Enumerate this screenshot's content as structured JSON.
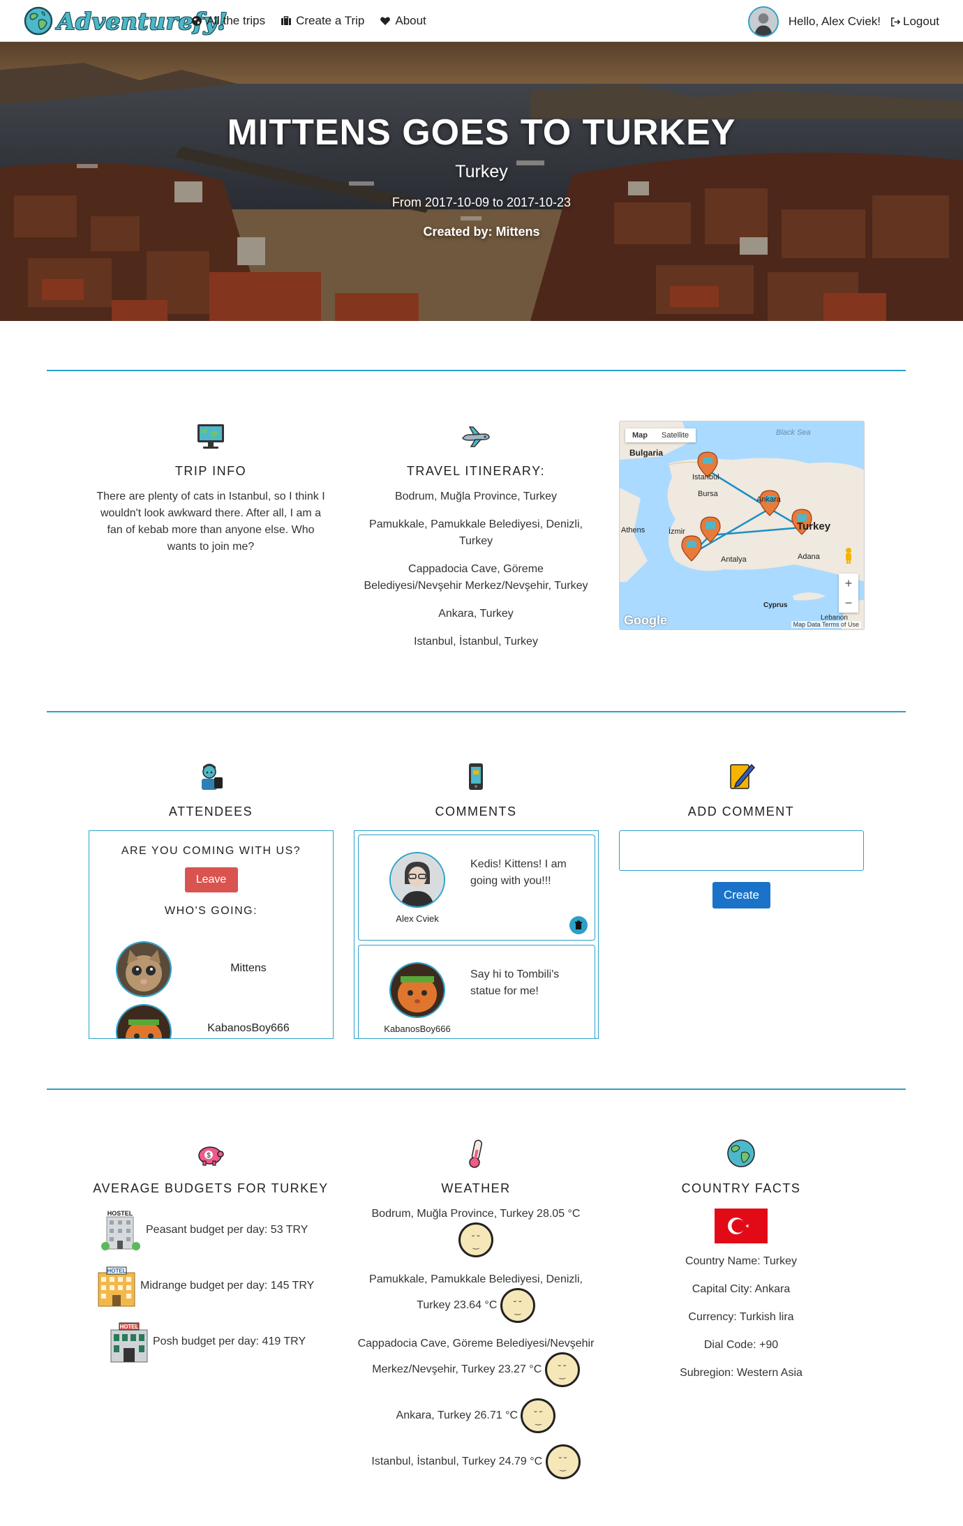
{
  "nav": {
    "brand": "Adventurefy!",
    "links": [
      {
        "label": "All the trips",
        "icon": "globe-icon"
      },
      {
        "label": "Create a Trip",
        "icon": "briefcase-icon"
      },
      {
        "label": "About",
        "icon": "heart-icon"
      }
    ],
    "greeting": "Hello, Alex Cviek!",
    "logout": "Logout"
  },
  "hero": {
    "title": "MITTENS GOES TO TURKEY",
    "country": "Turkey",
    "dates": "From 2017-10-09 to 2017-10-23",
    "creator": "Created by: Mittens"
  },
  "trip_info": {
    "heading": "TRIP INFO",
    "description": "There are plenty of cats in Istanbul, so I think I wouldn't look awkward there. After all, I am a fan of kebab more than anyone else. Who wants to join me?"
  },
  "itinerary": {
    "heading": "TRAVEL ITINERARY:",
    "items": [
      "Bodrum, Muğla Province, Turkey",
      "Pamukkale, Pamukkale Belediyesi, Denizli, Turkey",
      "Cappadocia Cave, Göreme Belediyesi/Nevşehir Merkez/Nevşehir, Turkey",
      "Ankara, Turkey",
      "Istanbul, İstanbul, Turkey"
    ]
  },
  "map": {
    "tab_map": "Map",
    "tab_satellite": "Satellite",
    "labels": {
      "black_sea": "Black Sea",
      "bulgaria": "Bulgaria",
      "istanbul": "Istanbul",
      "bursa": "Bursa",
      "ankara": "Ankara",
      "turkey": "Turkey",
      "izmir": "İzmir",
      "antalya": "Antalya",
      "adana": "Adana",
      "cyprus": "Cyprus",
      "lebanon": "Lebanon",
      "athens": "Athens"
    },
    "zoom_in": "+",
    "zoom_out": "−",
    "google": "Google",
    "footer": "Map Data   Terms of Use"
  },
  "attendees": {
    "heading": "ATTENDEES",
    "question": "ARE YOU COMING WITH US?",
    "leave_button": "Leave",
    "going_heading": "WHO'S GOING:",
    "people": [
      {
        "name": "Mittens"
      },
      {
        "name": "KabanosBoy666"
      }
    ]
  },
  "comments": {
    "heading": "COMMENTS",
    "items": [
      {
        "author": "Alex Cviek",
        "text": "Kedis! Kittens! I am going with you!!!"
      },
      {
        "author": "KabanosBoy666",
        "text": "Say hi to Tombili's statue for me!"
      }
    ]
  },
  "add_comment": {
    "heading": "ADD COMMENT",
    "value": "",
    "create_button": "Create"
  },
  "budgets": {
    "heading": "AVERAGE BUDGETS FOR TURKEY",
    "items": [
      {
        "label": "Peasant budget per day: 53 TRY",
        "icon": "hostel-icon",
        "sign": "HOSTEL"
      },
      {
        "label": "Midrange budget per day: 145 TRY",
        "icon": "hotel-icon",
        "sign": "HOTEL"
      },
      {
        "label": "Posh budget per day: 419 TRY",
        "icon": "luxury-hotel-icon",
        "sign": "HOTEL"
      }
    ]
  },
  "weather": {
    "heading": "WEATHER",
    "items": [
      {
        "place": "Bodrum, Muğla Province, Turkey",
        "temp": "28.05 °C"
      },
      {
        "place": "Pamukkale, Pamukkale Belediyesi, Denizli, Turkey",
        "temp": "23.64 °C"
      },
      {
        "place": "Cappadocia Cave, Göreme Belediyesi/Nevşehir Merkez/Nevşehir, Turkey",
        "temp": "23.27 °C"
      },
      {
        "place": "Ankara, Turkey",
        "temp": "26.71 °C"
      },
      {
        "place": "Istanbul, İstanbul, Turkey",
        "temp": "24.79 °C"
      }
    ],
    "icon": "moon-icon"
  },
  "country_facts": {
    "heading": "COUNTRY FACTS",
    "facts": [
      "Country Name: Turkey",
      "Capital City: Ankara",
      "Currency: Turkish lira",
      "Dial Code: +90",
      "Subregion: Western Asia"
    ]
  },
  "colors": {
    "accent": "#2ba0c9",
    "leave": "#d9534f",
    "create": "#1a73c9",
    "flag_red": "#e30a17"
  }
}
